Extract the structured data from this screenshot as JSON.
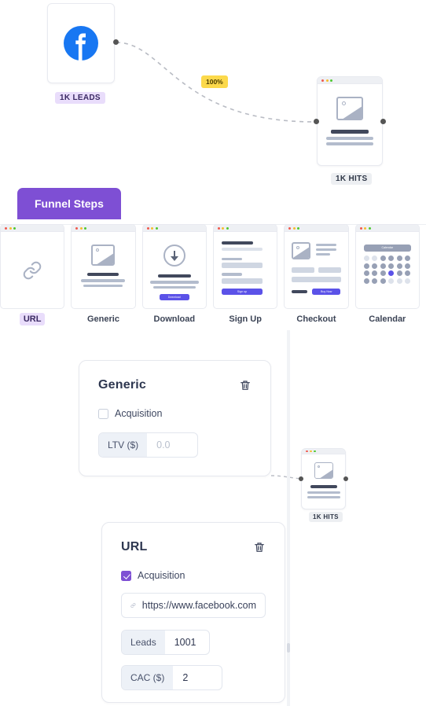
{
  "nodes": {
    "source": {
      "icon": "facebook-icon",
      "label": "1K LEADS"
    },
    "hits_top": {
      "icon": "image-placeholder-icon",
      "label": "1K HITS"
    },
    "hits_mini": {
      "icon": "image-placeholder-icon",
      "label": "1K HITS"
    }
  },
  "edges": {
    "conversion_badge": "100%"
  },
  "tab": {
    "label": "Funnel Steps"
  },
  "steps": [
    {
      "name": "URL",
      "icon": "chain-link-icon",
      "selected": true
    },
    {
      "name": "Generic",
      "icon": "image-placeholder-icon",
      "selected": false
    },
    {
      "name": "Download",
      "icon": "download-arrow-icon",
      "selected": false,
      "button": "Download"
    },
    {
      "name": "Sign Up",
      "icon": "form-icon",
      "selected": false,
      "button": "Sign up"
    },
    {
      "name": "Checkout",
      "icon": "cart-icon",
      "selected": false,
      "button": "Buy Now"
    },
    {
      "name": "Calendar",
      "icon": "calendar-icon",
      "selected": false,
      "pill": "Calendar"
    }
  ],
  "generic_card": {
    "title": "Generic",
    "delete_icon": "trash-icon",
    "acquisition": {
      "label": "Acquisition",
      "checked": false
    },
    "ltv": {
      "key": "LTV ($)",
      "value": "",
      "placeholder": "0.0"
    }
  },
  "url_card": {
    "title": "URL",
    "delete_icon": "trash-icon",
    "acquisition": {
      "label": "Acquisition",
      "checked": true
    },
    "url": {
      "icon": "chain-link-icon",
      "value": "https://www.facebook.com",
      "placeholder": "https://"
    },
    "leads": {
      "key": "Leads",
      "value": "1001"
    },
    "cac": {
      "key": "CAC ($)",
      "value": "2"
    }
  },
  "colors": {
    "accent_purple": "#7e4fd4",
    "badge_yellow": "#fcd94b",
    "facebook_blue": "#1877f2",
    "mini_button_blue": "#5b52e8"
  }
}
